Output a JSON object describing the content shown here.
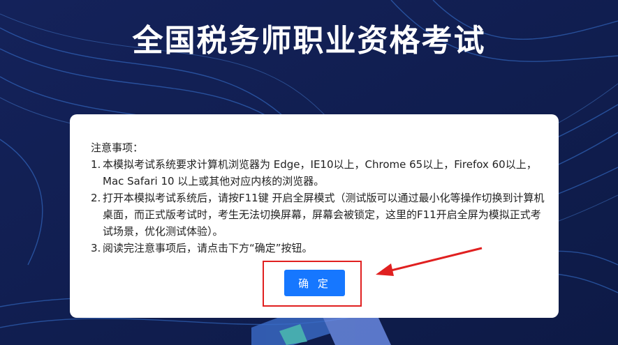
{
  "page": {
    "title": "全国税务师职业资格考试"
  },
  "notice": {
    "heading": "注意事项：",
    "items": [
      {
        "num": "1.",
        "text": "本模拟考试系统要求计算机浏览器为 Edge，IE10以上，Chrome 65以上，Firefox 60以上，Mac Safari 10 以上或其他对应内核的浏览器。"
      },
      {
        "num": "2.",
        "text": "打开本模拟考试系统后，请按F11键 开启全屏模式（测试版可以通过最小化等操作切换到计算机桌面，而正式版考试时，考生无法切换屏幕，屏幕会被锁定，这里的F11开启全屏为模拟正式考试场景，优化测试体验）。"
      },
      {
        "num": "3.",
        "text": "阅读完注意事项后，请点击下方“确定”按钮。"
      }
    ],
    "confirm_label": "确 定"
  },
  "colors": {
    "background": "#0f1d4e",
    "button": "#1677ff",
    "highlight": "#e02020"
  }
}
